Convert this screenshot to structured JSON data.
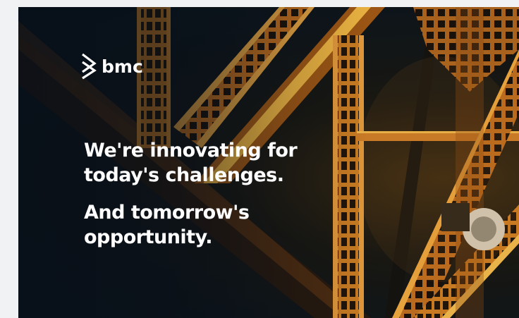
{
  "banner": {
    "logo": {
      "icon": "bmc-logo-icon",
      "text": "bmc"
    },
    "headline": "We're innovating for today's challenges.",
    "subline": "And tomorrow's opportunity.",
    "colors": {
      "girder": "#c8761e",
      "girder_highlight": "#e3a13a",
      "background_dark": "#0b1620",
      "text": "#ffffff"
    }
  }
}
